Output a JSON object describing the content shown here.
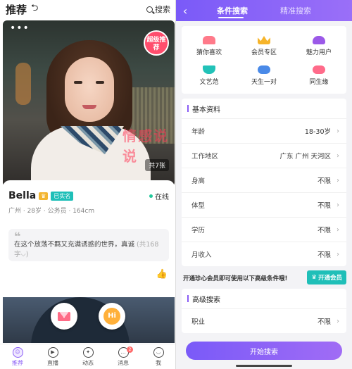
{
  "left": {
    "header": {
      "title": "推荐",
      "search_label": "搜索"
    },
    "photo": {
      "badge": "超级推荐",
      "count": "共7张",
      "watermark": "情感说说"
    },
    "profile": {
      "name": "Bella",
      "verified": "已实名",
      "online": "在线",
      "meta": "广州 · 28岁 · 公务员 · 164cm",
      "bio": "在这个放荡不羁又充满诱惑的世界，真诚",
      "bio_count": "(共168字⌵)"
    },
    "hi_label": "Hi",
    "nav": [
      {
        "label": "推荐",
        "active": true
      },
      {
        "label": "直播"
      },
      {
        "label": "动态"
      },
      {
        "label": "消息",
        "badge": "2"
      },
      {
        "label": "我"
      }
    ]
  },
  "right": {
    "tabs": [
      "条件搜索",
      "精准搜索"
    ],
    "categories": [
      {
        "label": "猜你喜欢",
        "color": "#ff7a8a"
      },
      {
        "label": "会员专区",
        "color": "#f6b42a"
      },
      {
        "label": "魅力用户",
        "color": "#9b59e8"
      },
      {
        "label": "文艺范",
        "color": "#22c2b8"
      },
      {
        "label": "天生一对",
        "color": "#4a8ae8"
      },
      {
        "label": "同生缘",
        "color": "#ff6b8a"
      }
    ],
    "basic": {
      "title": "基本资料",
      "rows": [
        {
          "label": "年龄",
          "value": "18-30岁"
        },
        {
          "label": "工作地区",
          "value": "广东 广州 天河区"
        },
        {
          "label": "身高",
          "value": "不限"
        },
        {
          "label": "体型",
          "value": "不限"
        },
        {
          "label": "学历",
          "value": "不限"
        },
        {
          "label": "月收入",
          "value": "不限"
        }
      ]
    },
    "vip": {
      "text": "开通珍心会员即可使用以下高级条件哦!",
      "button": "开通会员"
    },
    "advanced": {
      "title": "高级搜索",
      "rows": [
        {
          "label": "职业",
          "value": "不限"
        }
      ]
    },
    "start_button": "开始搜索"
  }
}
